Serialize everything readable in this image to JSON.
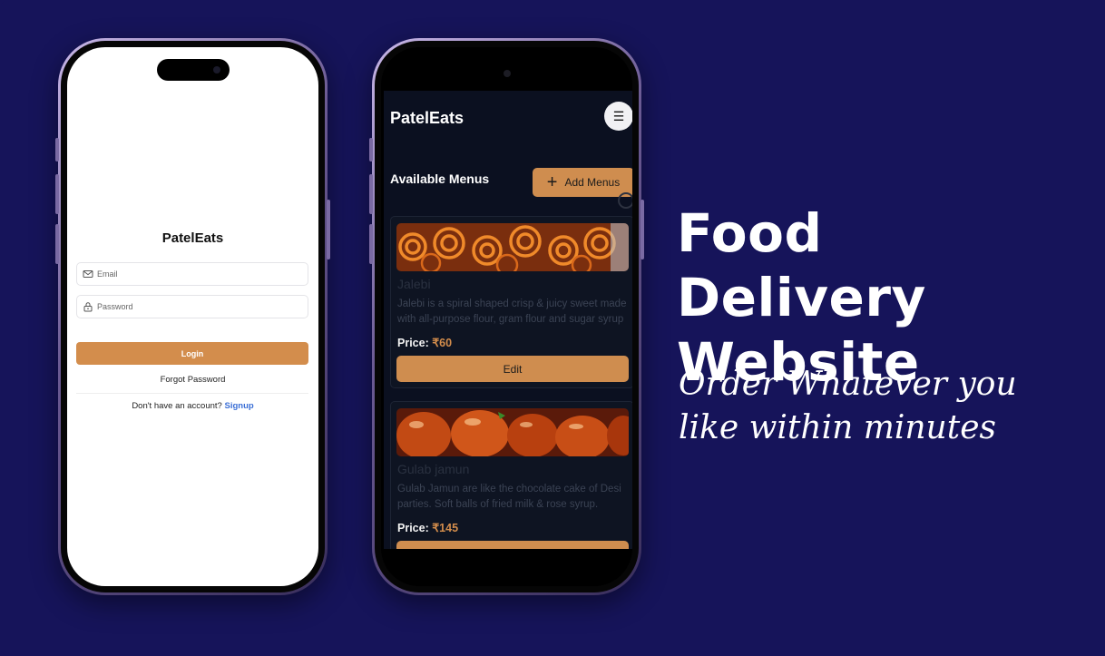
{
  "colors": {
    "background": "#16145a",
    "accent": "#cf8d4f",
    "link": "#3b6fd6"
  },
  "login_screen": {
    "brand": "PatelEats",
    "email_placeholder": "Email",
    "password_placeholder": "Password",
    "login_label": "Login",
    "forgot_label": "Forgot Password",
    "no_account_text": "Don't have an account?",
    "signup_label": "Signup"
  },
  "menu_screen": {
    "brand": "PatelEats",
    "menu_icon": "hamburger-icon",
    "heading": "Available Menus",
    "add_button_label": "Add Menus",
    "items": [
      {
        "name": "Jalebi",
        "description": "Jalebi is a spiral shaped crisp & juicy sweet made with all-purpose flour, gram flour and sugar syrup",
        "price_label": "Price:",
        "price": "₹60",
        "button_label": "Edit"
      },
      {
        "name": "Gulab jamun",
        "description": "Gulab Jamun are like the chocolate cake of Desi parties. Soft balls of fried milk & rose syrup.",
        "price_label": "Price:",
        "price": "₹145",
        "button_label": ""
      }
    ]
  },
  "promo": {
    "headline_line1": "Food Delivery",
    "headline_line2": "Website",
    "tagline_line1": "Order Whatever you",
    "tagline_line2": "like within minutes"
  }
}
